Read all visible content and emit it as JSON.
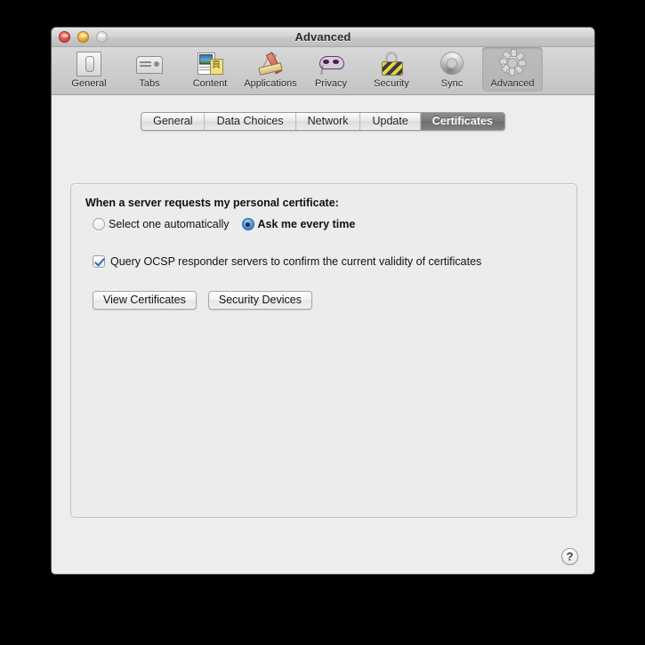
{
  "window": {
    "title": "Advanced",
    "controls": [
      {
        "name": "close-button",
        "label": ""
      },
      {
        "name": "minimize-button",
        "label": ""
      },
      {
        "name": "zoom-button",
        "label": ""
      }
    ]
  },
  "toolbar": {
    "items": [
      {
        "label": "General",
        "icon": "general-icon",
        "selected": false
      },
      {
        "label": "Tabs",
        "icon": "tabs-icon",
        "selected": false
      },
      {
        "label": "Content",
        "icon": "content-icon",
        "selected": false
      },
      {
        "label": "Applications",
        "icon": "applications-icon",
        "selected": false
      },
      {
        "label": "Privacy",
        "icon": "privacy-mask-icon",
        "selected": false
      },
      {
        "label": "Security",
        "icon": "padlock-icon",
        "selected": false
      },
      {
        "label": "Sync",
        "icon": "sync-arrows-icon",
        "selected": false
      },
      {
        "label": "Advanced",
        "icon": "gear-icon",
        "selected": true
      }
    ]
  },
  "tabs": {
    "items": [
      {
        "label": "General",
        "active": false
      },
      {
        "label": "Data Choices",
        "active": false
      },
      {
        "label": "Network",
        "active": false
      },
      {
        "label": "Update",
        "active": false
      },
      {
        "label": "Certificates",
        "active": true
      }
    ]
  },
  "certificates": {
    "section_label": "When a server requests my personal certificate:",
    "radio_options": [
      {
        "label": "Select one automatically",
        "selected": false
      },
      {
        "label": "Ask me every time",
        "selected": true
      }
    ],
    "ocsp": {
      "label": "Query OCSP responder servers to confirm the current validity of certificates",
      "checked": true
    },
    "buttons": [
      {
        "label": "View Certificates"
      },
      {
        "label": "Security Devices"
      }
    ]
  },
  "help": {
    "label": "?"
  },
  "colors": {
    "accent_blue": "#2a6bb5",
    "radio_blue": "#4b95dd",
    "tab_active_bg": "#777777",
    "window_bg": "#ededed",
    "panel_bg": "#ececec",
    "desktop_bg": "#000000"
  }
}
